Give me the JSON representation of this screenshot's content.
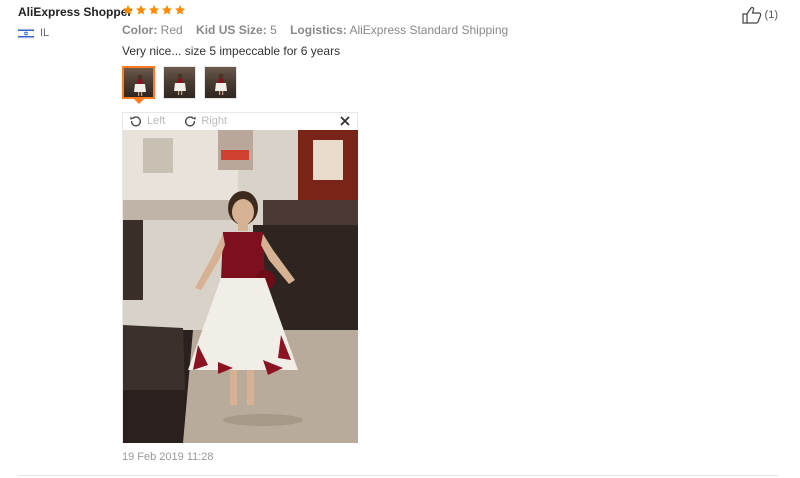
{
  "review": {
    "reviewer": "AliExpress Shopper",
    "rating": 5,
    "country": "IL",
    "sku": {
      "color_label": "Color:",
      "color_value": "Red",
      "size_label": "Kid US Size:",
      "size_value": "5",
      "logistics_label": "Logistics:",
      "logistics_value": "AliExpress Standard Shipping"
    },
    "text": "Very nice... size 5 impeccable for 6 years",
    "image_count": 3,
    "viewer": {
      "rotate_left": "Left",
      "rotate_right": "Right"
    },
    "date": "19 Feb 2019 11:28",
    "likes": "(1)"
  },
  "colors": {
    "accent": "#ff7b1f",
    "star": "#ff8a00"
  },
  "icons": [
    "star-icon",
    "israel-flag-icon",
    "rotate-left-icon",
    "rotate-right-icon",
    "close-icon",
    "thumbs-up-icon"
  ]
}
